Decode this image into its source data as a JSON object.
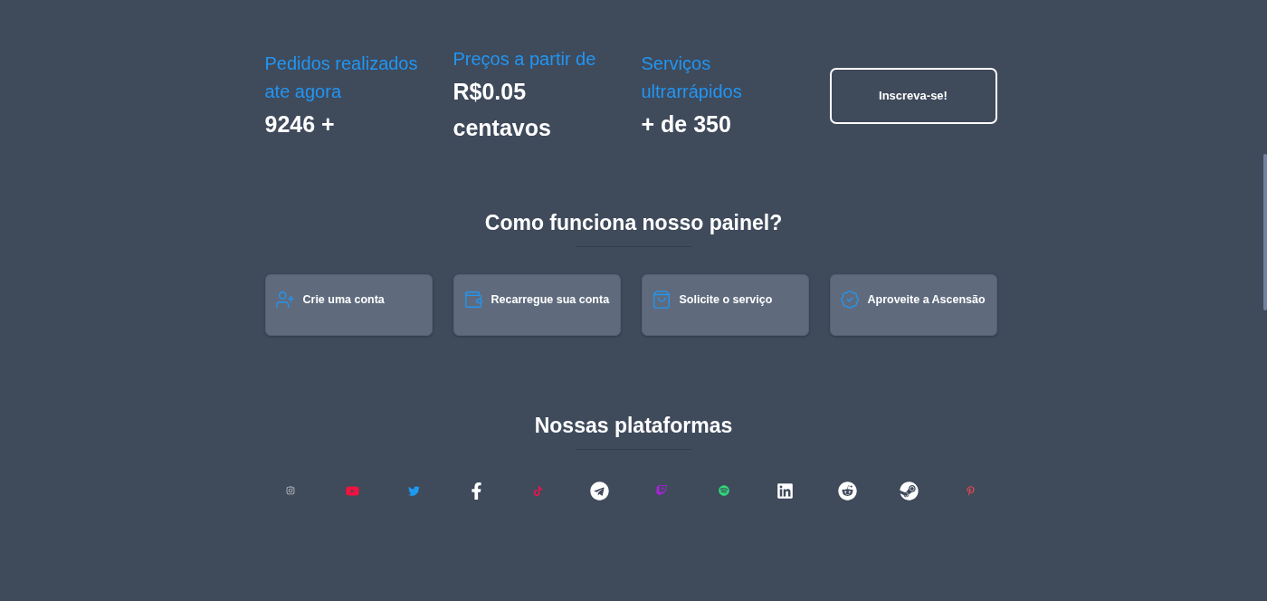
{
  "stats": [
    {
      "label": "Pedidos realizados ate agora",
      "value": "9246 +"
    },
    {
      "label": "Preços a partir de",
      "value": "R$0.05 centavos"
    },
    {
      "label": "Serviços ultrarrápidos",
      "value": "+ de 350"
    }
  ],
  "signup_button": {
    "label": "Inscreva-se!"
  },
  "how_it_works": {
    "title": "Como funciona nosso painel?",
    "steps": [
      {
        "label": "Crie uma conta"
      },
      {
        "label": "Recarregue sua conta"
      },
      {
        "label": "Solicite o serviço"
      },
      {
        "label": "Aproveite a Ascensão"
      }
    ]
  },
  "platforms": {
    "title": "Nossas plataformas"
  }
}
